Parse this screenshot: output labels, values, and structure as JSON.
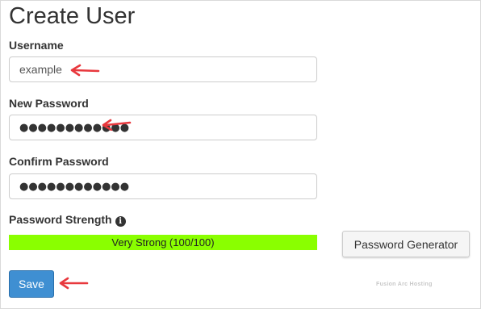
{
  "page": {
    "title": "Create User"
  },
  "form": {
    "username": {
      "label": "Username",
      "value": "example"
    },
    "new_password": {
      "label": "New Password",
      "masked_value": "●●●●●●●●●●●●"
    },
    "confirm_password": {
      "label": "Confirm Password",
      "masked_value": "●●●●●●●●●●●●"
    },
    "strength": {
      "label": "Password Strength",
      "info_icon": "info-circle-icon",
      "text": "Very Strong (100/100)",
      "score": 100,
      "max": 100,
      "color": "#8aff00"
    }
  },
  "buttons": {
    "generator_label": "Password Generator",
    "save_label": "Save",
    "save_color": "#3f8fd2"
  },
  "annotations": {
    "arrow_icon": "red-arrow-icon",
    "arrow_color": "#e8383d"
  },
  "watermark": {
    "text": "Fusion Arc Hosting"
  }
}
